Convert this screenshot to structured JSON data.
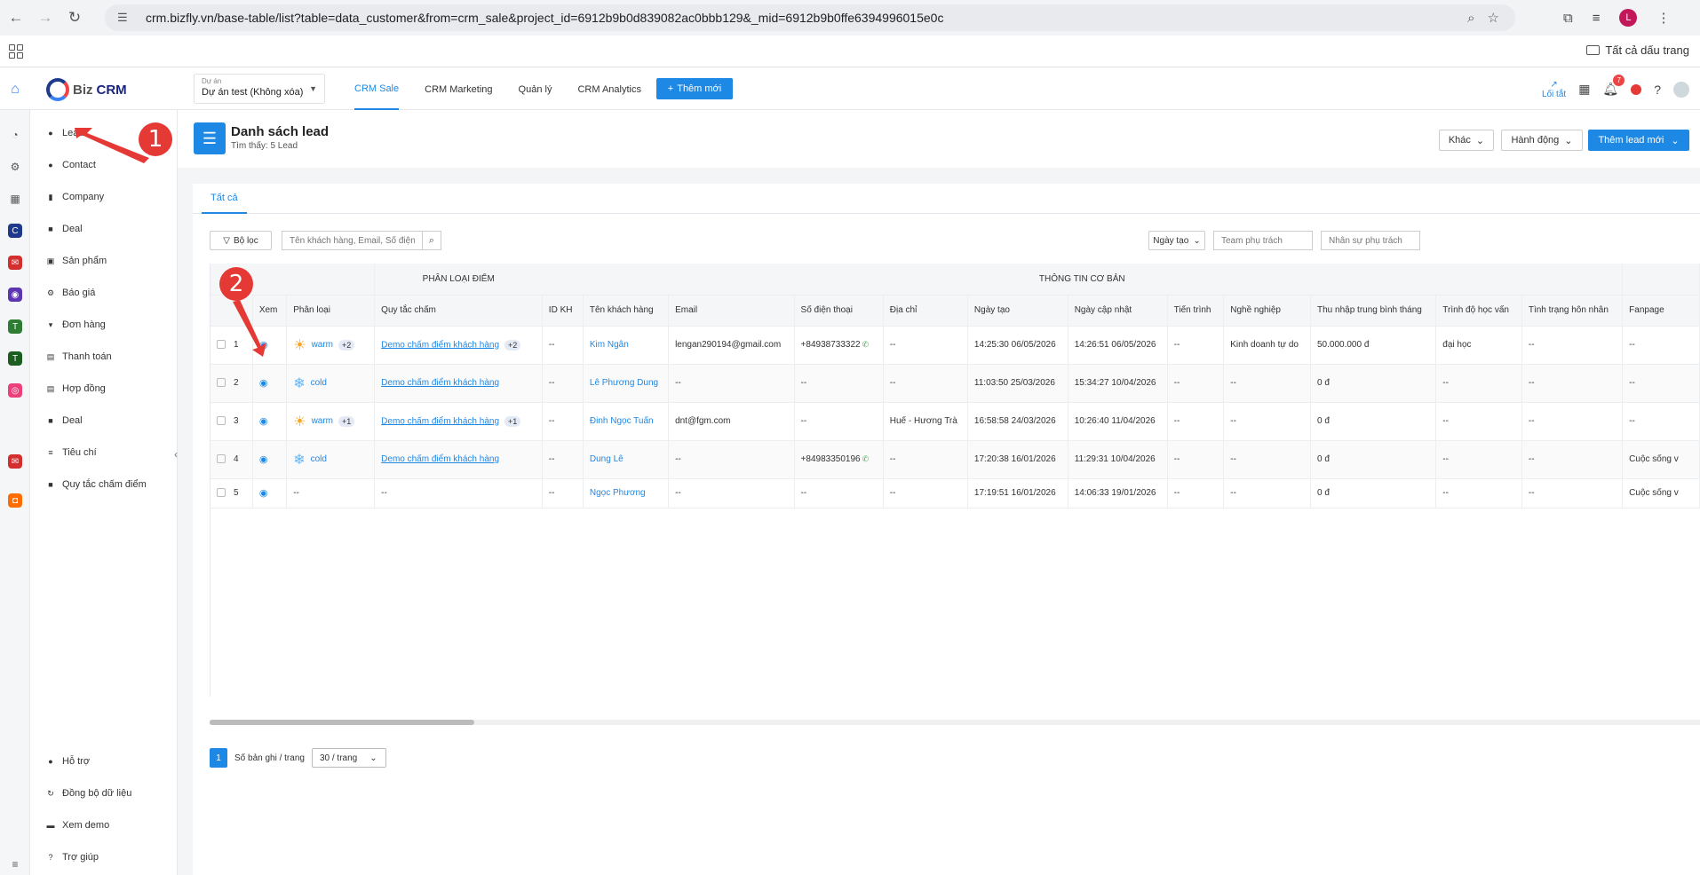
{
  "browser": {
    "url": "crm.bizfly.vn/base-table/list?table=data_customer&from=crm_sale&project_id=6912b9b0d839082ac0bbb129&_mid=6912b9b0ffe6394996015e0c",
    "bookmarks_label": "Tất cả dấu trang",
    "profile_initial": "L"
  },
  "header": {
    "logo_biz": "Biz",
    "logo_crm": "CRM",
    "project_label": "Dự án",
    "project_value": "Dự án test (Không xóa)",
    "menu": [
      "CRM Sale",
      "CRM Marketing",
      "Quản lý",
      "CRM Analytics"
    ],
    "add_new": "Thêm mới",
    "shortcut": "Lối tắt",
    "notif_count": "7"
  },
  "sidebar": {
    "items": [
      "Lead",
      "Contact",
      "Company",
      "Deal",
      "Sản phẩm",
      "Báo giá",
      "Đơn hàng",
      "Thanh toán",
      "Hợp đồng",
      "Deal",
      "Tiêu chí",
      "Quy tắc chấm điểm"
    ],
    "bottom": [
      "Hỗ trợ",
      "Đồng bộ dữ liệu",
      "Xem demo",
      "Trợ giúp"
    ]
  },
  "page": {
    "title": "Danh sách lead",
    "subtitle": "Tìm thấy: 5 Lead",
    "btn_other": "Khác",
    "btn_action": "Hành động",
    "btn_add_lead": "Thêm lead mới",
    "tab_all": "Tất cả",
    "filter": "Bộ lọc",
    "search_placeholder": "Tên khách hàng, Email, Số điện thoại",
    "date_filter": "Ngày tạo",
    "team_placeholder": "Team phụ trách",
    "staff_placeholder": "Nhân sự phụ trách"
  },
  "table": {
    "group_headers": [
      "PHÂN LOẠI ĐIỂM",
      "THÔNG TIN CƠ BẢN"
    ],
    "columns": [
      "Xem",
      "Phân loại",
      "Quy tắc chấm",
      "ID KH",
      "Tên khách hàng",
      "Email",
      "Số điện thoại",
      "Địa chỉ",
      "Ngày tạo",
      "Ngày cập nhật",
      "Tiến trình",
      "Nghề nghiệp",
      "Thu nhập trung bình tháng",
      "Trình độ học vấn",
      "Tình trạng hôn nhân",
      "Fanpage"
    ],
    "rows": [
      {
        "idx": "1",
        "cls": "warm",
        "icon": "sun",
        "cls_more": "+2",
        "rule": "Demo chấm điểm khách hàng",
        "rule_more": "+2",
        "id": "--",
        "name": "Kim Ngân",
        "email": "lengan290194@gmail.com",
        "phone": "+84938733322",
        "phone_icon": true,
        "addr": "--",
        "created": "14:25:30 06/05/2026",
        "updated": "14:26:51 06/05/2026",
        "progress": "--",
        "job": "Kinh doanh tự do",
        "income": "50.000.000 đ",
        "edu": "đại học",
        "marital": "--",
        "fanpage": "--"
      },
      {
        "idx": "2",
        "cls": "cold",
        "icon": "snow",
        "cls_more": "",
        "rule": "Demo chấm điểm khách hàng",
        "rule_more": "",
        "id": "--",
        "name": "Lê Phương Dung",
        "email": "--",
        "phone": "--",
        "phone_icon": false,
        "addr": "--",
        "created": "11:03:50 25/03/2026",
        "updated": "15:34:27 10/04/2026",
        "progress": "--",
        "job": "--",
        "income": "0 đ",
        "edu": "--",
        "marital": "--",
        "fanpage": "--"
      },
      {
        "idx": "3",
        "cls": "warm",
        "icon": "sun",
        "cls_more": "+1",
        "rule": "Demo chấm điểm khách hàng",
        "rule_more": "+1",
        "id": "--",
        "name": "Đinh Ngọc Tuấn",
        "email": "dnt@fgm.com",
        "phone": "--",
        "phone_icon": false,
        "addr": "Huế - Hương Trà",
        "created": "16:58:58 24/03/2026",
        "updated": "10:26:40 11/04/2026",
        "progress": "--",
        "job": "--",
        "income": "0 đ",
        "edu": "--",
        "marital": "--",
        "fanpage": "--"
      },
      {
        "idx": "4",
        "cls": "cold",
        "icon": "snow",
        "cls_more": "",
        "rule": "Demo chấm điểm khách hàng",
        "rule_more": "",
        "id": "--",
        "name": "Dung Lê",
        "email": "--",
        "phone": "+84983350196",
        "phone_icon": true,
        "addr": "--",
        "created": "17:20:38 16/01/2026",
        "updated": "11:29:31 10/04/2026",
        "progress": "--",
        "job": "--",
        "income": "0 đ",
        "edu": "--",
        "marital": "--",
        "fanpage": "Cuộc sống v"
      },
      {
        "idx": "5",
        "cls": "",
        "icon": "",
        "cls_more": "",
        "rule": "",
        "rule_more": "",
        "cls_empty": "--",
        "rule_empty": "--",
        "id": "--",
        "name": "Ngọc Phương",
        "email": "--",
        "phone": "--",
        "phone_icon": false,
        "addr": "--",
        "created": "17:19:51 16/01/2026",
        "updated": "14:06:33 19/01/2026",
        "progress": "--",
        "job": "--",
        "income": "0 đ",
        "edu": "--",
        "marital": "--",
        "fanpage": "Cuộc sống v"
      }
    ]
  },
  "pagination": {
    "page": "1",
    "per_page_label": "Số bản ghi / trang",
    "per_page_value": "30 / trang"
  },
  "annotations": [
    "1",
    "2"
  ],
  "colors": {
    "accent": "#1e88e5",
    "annotation": "#e53935"
  }
}
